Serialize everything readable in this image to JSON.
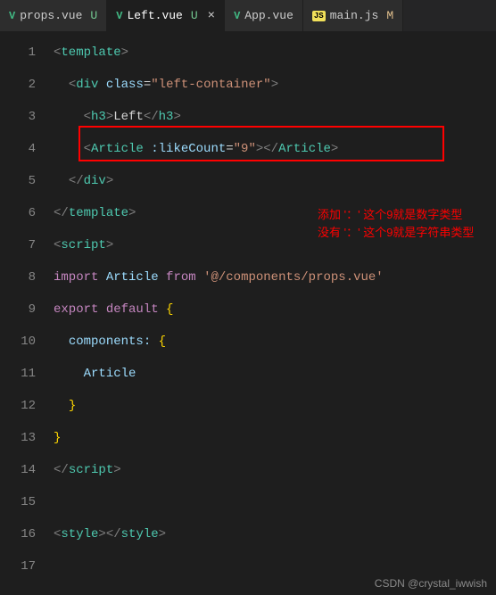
{
  "tabs": [
    {
      "icon": "vue",
      "name": "props.vue",
      "status": "U",
      "active": false
    },
    {
      "icon": "vue",
      "name": "Left.vue",
      "status": "U",
      "active": true,
      "close": "×"
    },
    {
      "icon": "vue",
      "name": "App.vue",
      "status": "",
      "active": false
    },
    {
      "icon": "js",
      "name": "main.js",
      "status": "M",
      "active": false
    }
  ],
  "lines": [
    "1",
    "2",
    "3",
    "4",
    "5",
    "6",
    "7",
    "8",
    "9",
    "10",
    "11",
    "12",
    "13",
    "14",
    "15",
    "16",
    "17"
  ],
  "code": {
    "template_open": "template",
    "div": "div",
    "class_attr": "class",
    "class_val": "\"left-container\"",
    "h3": "h3",
    "h3_text": "Left",
    "article": "Article",
    "like_attr": ":likeCount",
    "like_val": "\"9\"",
    "script": "script",
    "import_kw": "import",
    "article_var": "Article",
    "from_kw": "from",
    "import_path": "'@/components/props.vue'",
    "export_kw": "export",
    "default_kw": "default",
    "components_key": "components:",
    "article_comp": "Article",
    "style": "style"
  },
  "annotation": {
    "line1": "添加 '：' 这个9就是数字类型",
    "line2": "没有 '：' 这个9就是字符串类型"
  },
  "watermark": "CSDN @crystal_iwwish"
}
